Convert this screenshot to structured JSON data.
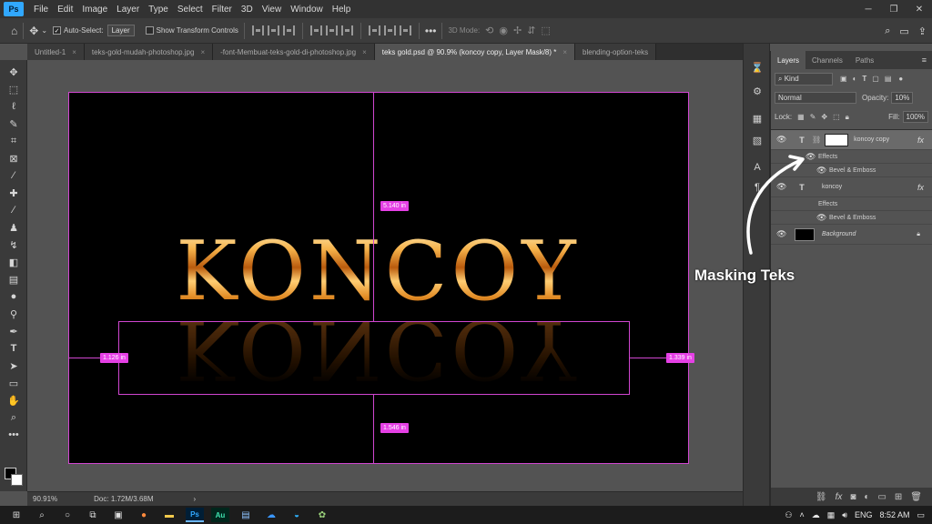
{
  "menubar": {
    "logo": "Ps",
    "items": [
      "File",
      "Edit",
      "Image",
      "Layer",
      "Type",
      "Select",
      "Filter",
      "3D",
      "View",
      "Window",
      "Help"
    ]
  },
  "options": {
    "auto_select_label": "Auto-Select:",
    "auto_select_value": "Layer",
    "transform_label": "Show Transform Controls",
    "mode_3d": "3D Mode:"
  },
  "tabs": [
    {
      "label": "Untitled-1"
    },
    {
      "label": "teks-gold-mudah-photoshop.jpg"
    },
    {
      "label": "-font-Membuat-teks-gold-di-photoshop.jpg"
    },
    {
      "label": "teks gold.psd @ 90.9% (koncoy copy, Layer Mask/8) *"
    },
    {
      "label": "blending-option-teks"
    }
  ],
  "canvas": {
    "main_text": "KONCOY",
    "reflection_text": "KONCOY",
    "measure_top": "5.140 in",
    "measure_left": "1.126 in",
    "measure_right": "1.339 in",
    "measure_bottom": "1.546 in"
  },
  "status": {
    "zoom": "90.91%",
    "doc": "Doc: 1.72M/3.68M",
    "arrow": "›"
  },
  "panel": {
    "tabs": [
      "Layers",
      "Channels",
      "Paths"
    ],
    "kind": "Kind",
    "blend": "Normal",
    "opacity_label": "Opacity:",
    "opacity_value": "10%",
    "lock_label": "Lock:",
    "fill_label": "Fill:",
    "fill_value": "100%",
    "layers": [
      {
        "name": "koncoy copy",
        "effects": "Effects",
        "effect1": "Bevel & Emboss"
      },
      {
        "name": "koncoy",
        "effects": "Effects",
        "effect1": "Bevel & Emboss"
      },
      {
        "name": "Background"
      }
    ]
  },
  "callout": "Masking Teks",
  "taskbar": {
    "lang": "ENG",
    "time": "8:52 AM"
  },
  "colors": {
    "guide": "#d146d1",
    "measure": "#e540e5",
    "ps_blue": "#31a8ff"
  }
}
